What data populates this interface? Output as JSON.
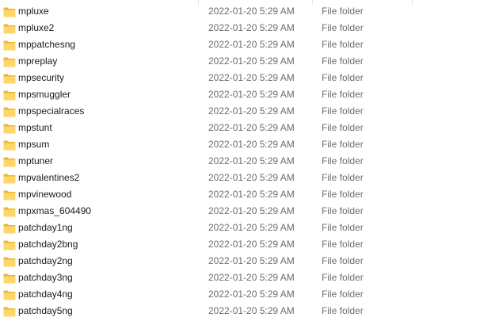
{
  "file_list": {
    "items": [
      {
        "name": "mpluxe",
        "date_modified": "2022-01-20 5:29 AM",
        "type": "File folder"
      },
      {
        "name": "mpluxe2",
        "date_modified": "2022-01-20 5:29 AM",
        "type": "File folder"
      },
      {
        "name": "mppatchesng",
        "date_modified": "2022-01-20 5:29 AM",
        "type": "File folder"
      },
      {
        "name": "mpreplay",
        "date_modified": "2022-01-20 5:29 AM",
        "type": "File folder"
      },
      {
        "name": "mpsecurity",
        "date_modified": "2022-01-20 5:29 AM",
        "type": "File folder"
      },
      {
        "name": "mpsmuggler",
        "date_modified": "2022-01-20 5:29 AM",
        "type": "File folder"
      },
      {
        "name": "mpspecialraces",
        "date_modified": "2022-01-20 5:29 AM",
        "type": "File folder"
      },
      {
        "name": "mpstunt",
        "date_modified": "2022-01-20 5:29 AM",
        "type": "File folder"
      },
      {
        "name": "mpsum",
        "date_modified": "2022-01-20 5:29 AM",
        "type": "File folder"
      },
      {
        "name": "mptuner",
        "date_modified": "2022-01-20 5:29 AM",
        "type": "File folder"
      },
      {
        "name": "mpvalentines2",
        "date_modified": "2022-01-20 5:29 AM",
        "type": "File folder"
      },
      {
        "name": "mpvinewood",
        "date_modified": "2022-01-20 5:29 AM",
        "type": "File folder"
      },
      {
        "name": "mpxmas_604490",
        "date_modified": "2022-01-20 5:29 AM",
        "type": "File folder"
      },
      {
        "name": "patchday1ng",
        "date_modified": "2022-01-20 5:29 AM",
        "type": "File folder"
      },
      {
        "name": "patchday2bng",
        "date_modified": "2022-01-20 5:29 AM",
        "type": "File folder"
      },
      {
        "name": "patchday2ng",
        "date_modified": "2022-01-20 5:29 AM",
        "type": "File folder"
      },
      {
        "name": "patchday3ng",
        "date_modified": "2022-01-20 5:29 AM",
        "type": "File folder"
      },
      {
        "name": "patchday4ng",
        "date_modified": "2022-01-20 5:29 AM",
        "type": "File folder"
      },
      {
        "name": "patchday5ng",
        "date_modified": "2022-01-20 5:29 AM",
        "type": "File folder"
      }
    ],
    "icon": "folder-icon",
    "colors": {
      "folder_body": "#FFD768",
      "folder_back": "#E8B73A",
      "text": "#1a1a1a",
      "secondary_text": "#6d6d6d"
    }
  }
}
